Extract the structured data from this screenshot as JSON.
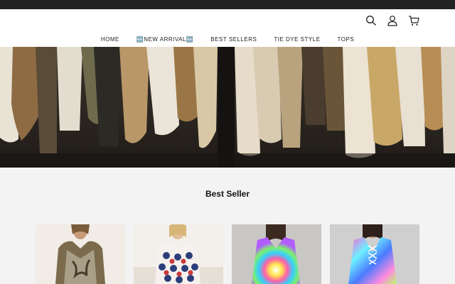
{
  "header": {
    "icons": [
      "search-icon",
      "user-icon",
      "cart-icon"
    ]
  },
  "nav": {
    "items": [
      {
        "label": "HOME"
      },
      {
        "label": "🆕NEW ARRIVAL🆕"
      },
      {
        "label": "BEST SELLERS"
      },
      {
        "label": "TIE DYE STYLE"
      },
      {
        "label": "TOPS"
      }
    ]
  },
  "section": {
    "title": "Best Seller"
  },
  "colors": {
    "topbar": "#222222",
    "header_bg": "#ffffff",
    "page_bg": "#f3f3f3"
  }
}
